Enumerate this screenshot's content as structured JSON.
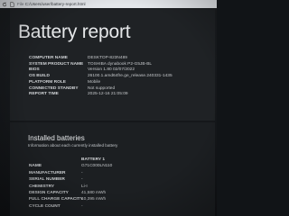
{
  "browser": {
    "url_scheme": "File",
    "url_path": "C:/Users/user/battery-report.html"
  },
  "report": {
    "title": "Battery report",
    "info": [
      {
        "label": "COMPUTER NAME",
        "value": "DESKTOP-823N489"
      },
      {
        "label": "SYSTEM PRODUCT NAME",
        "value": "TOSHIBA dynabook P2-G5JB-BL"
      },
      {
        "label": "BIOS",
        "value": "Version 1.80 02/07/2022"
      },
      {
        "label": "OS BUILD",
        "value": "26100.1.amd64fre.ge_release.240331-1435"
      },
      {
        "label": "PLATFORM ROLE",
        "value": "Mobile"
      },
      {
        "label": "CONNECTED STANDBY",
        "value": "Not supported"
      },
      {
        "label": "REPORT TIME",
        "value": "2025-12-16  21:05:09"
      }
    ]
  },
  "batteries": {
    "title": "Installed batteries",
    "subtitle": "Information about each currently installed battery",
    "header_label": "",
    "header_value": "BATTERY 1",
    "rows": [
      {
        "label": "NAME",
        "value": "G71C000LN110"
      },
      {
        "label": "MANUFACTURER",
        "value": "-"
      },
      {
        "label": "SERIAL NUMBER",
        "value": "-"
      },
      {
        "label": "CHEMISTRY",
        "value": "Li-I"
      },
      {
        "label": "DESIGN CAPACITY",
        "value": "41,580 mWh"
      },
      {
        "label": "FULL CHARGE CAPACITY",
        "value": "10,395 mWh"
      },
      {
        "label": "CYCLE COUNT",
        "value": "-"
      }
    ]
  }
}
